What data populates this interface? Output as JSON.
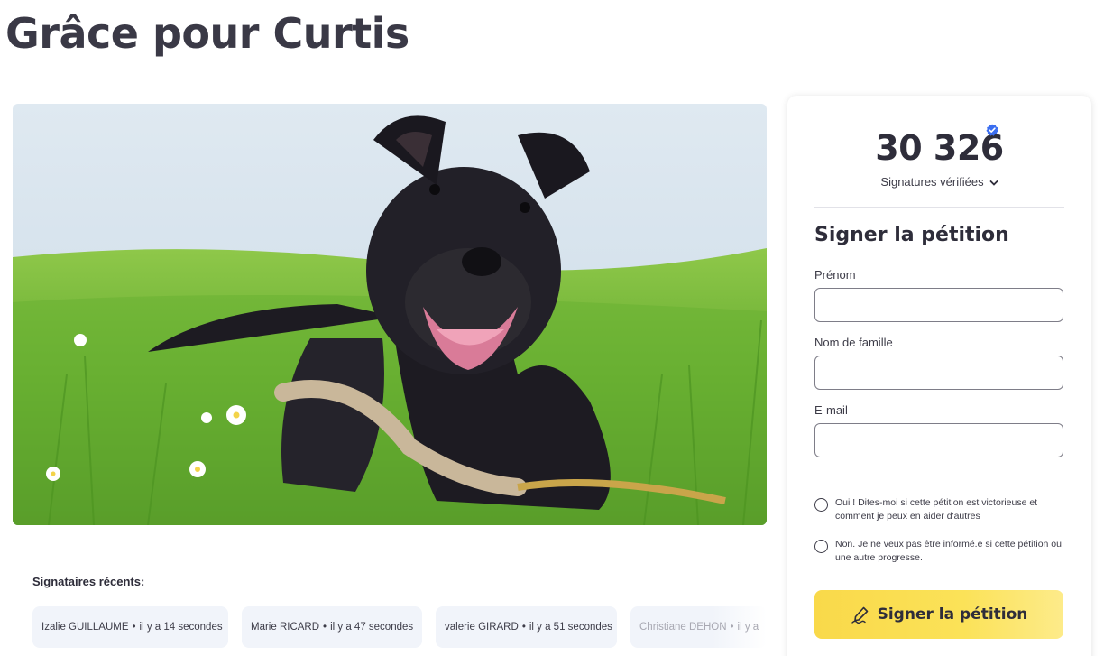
{
  "page": {
    "title": "Grâce pour Curtis"
  },
  "recent": {
    "title": "Signataires récents:",
    "items": [
      {
        "name": "Izalie GUILLAUME",
        "time": "il y a 14 secondes"
      },
      {
        "name": "Marie RICARD",
        "time": "il y a 47 secondes"
      },
      {
        "name": "valerie GIRARD",
        "time": "il y a 51 secondes"
      },
      {
        "name": "Christiane DEHON",
        "time": "il y a"
      }
    ],
    "separator": "•"
  },
  "card": {
    "count": "30 326",
    "verified_label": "Signatures vérifiées",
    "form_title": "Signer la pétition",
    "fields": {
      "first_name": {
        "label": "Prénom",
        "value": ""
      },
      "last_name": {
        "label": "Nom de famille",
        "value": ""
      },
      "email": {
        "label": "E-mail",
        "value": ""
      }
    },
    "options": {
      "yes": "Oui ! Dites-moi si cette pétition est victorieuse et comment je peux en aider d'autres",
      "no": "Non. Je ne veux pas être informé.e si cette pétition ou une autre progresse."
    },
    "submit_label": "Signer la pétition"
  },
  "icons": {
    "verified": "verified-badge-icon",
    "chevron": "chevron-down-icon",
    "sign": "pen-signature-icon"
  },
  "colors": {
    "accent_yellow": "#f9d94a",
    "verified_blue": "#3b6ef0",
    "text_dark": "#2e2d3a"
  }
}
